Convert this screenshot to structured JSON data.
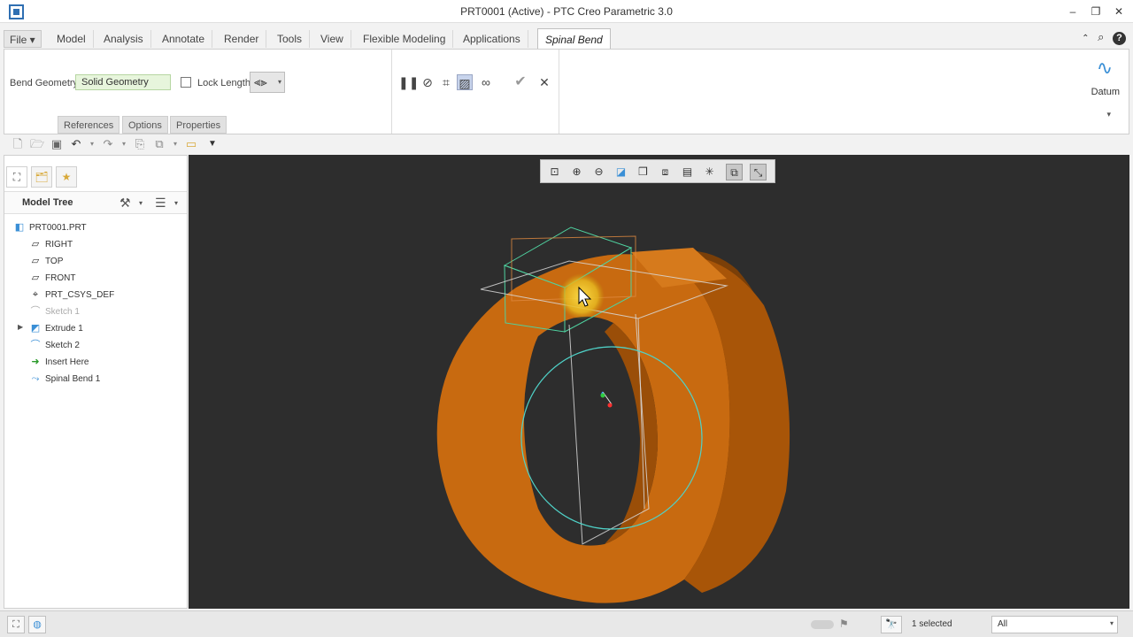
{
  "window": {
    "title": "PRT0001 (Active) - PTC Creo Parametric 3.0",
    "minimize_icon": "minimize-icon",
    "restore_icon": "restore-icon",
    "close_icon": "close-icon"
  },
  "tabs": {
    "file": "File",
    "items": [
      "Model",
      "Analysis",
      "Annotate",
      "Render",
      "Tools",
      "View",
      "Flexible Modeling",
      "Applications"
    ],
    "active": "Spinal Bend"
  },
  "ribbon": {
    "bend_geometry_label": "Bend Geometry",
    "bend_geometry_value": "Solid Geometry",
    "lock_length_label": "Lock Length",
    "subtabs": [
      "References",
      "Options",
      "Properties"
    ],
    "datum_label": "Datum"
  },
  "model_tree": {
    "title": "Model Tree",
    "items": [
      {
        "label": "PRT0001.PRT",
        "icon": "part-icon"
      },
      {
        "label": "RIGHT",
        "icon": "datum-plane-icon"
      },
      {
        "label": "TOP",
        "icon": "datum-plane-icon"
      },
      {
        "label": "FRONT",
        "icon": "datum-plane-icon"
      },
      {
        "label": "PRT_CSYS_DEF",
        "icon": "csys-icon"
      },
      {
        "label": "Sketch 1",
        "icon": "sketch-icon"
      },
      {
        "label": "Extrude 1",
        "icon": "extrude-icon"
      },
      {
        "label": "Sketch 2",
        "icon": "sketch-icon"
      },
      {
        "label": "Insert Here",
        "icon": "insert-arrow-icon"
      },
      {
        "label": "Spinal Bend 1",
        "icon": "spinal-bend-icon"
      }
    ]
  },
  "statusbar": {
    "selection": "1 selected",
    "filter": "All"
  },
  "colors": {
    "accent": "#2f6fb2",
    "part_orange": "#c8680f",
    "viewport_bg": "#2d2d2d",
    "datum_green": "#4fd2a0"
  }
}
